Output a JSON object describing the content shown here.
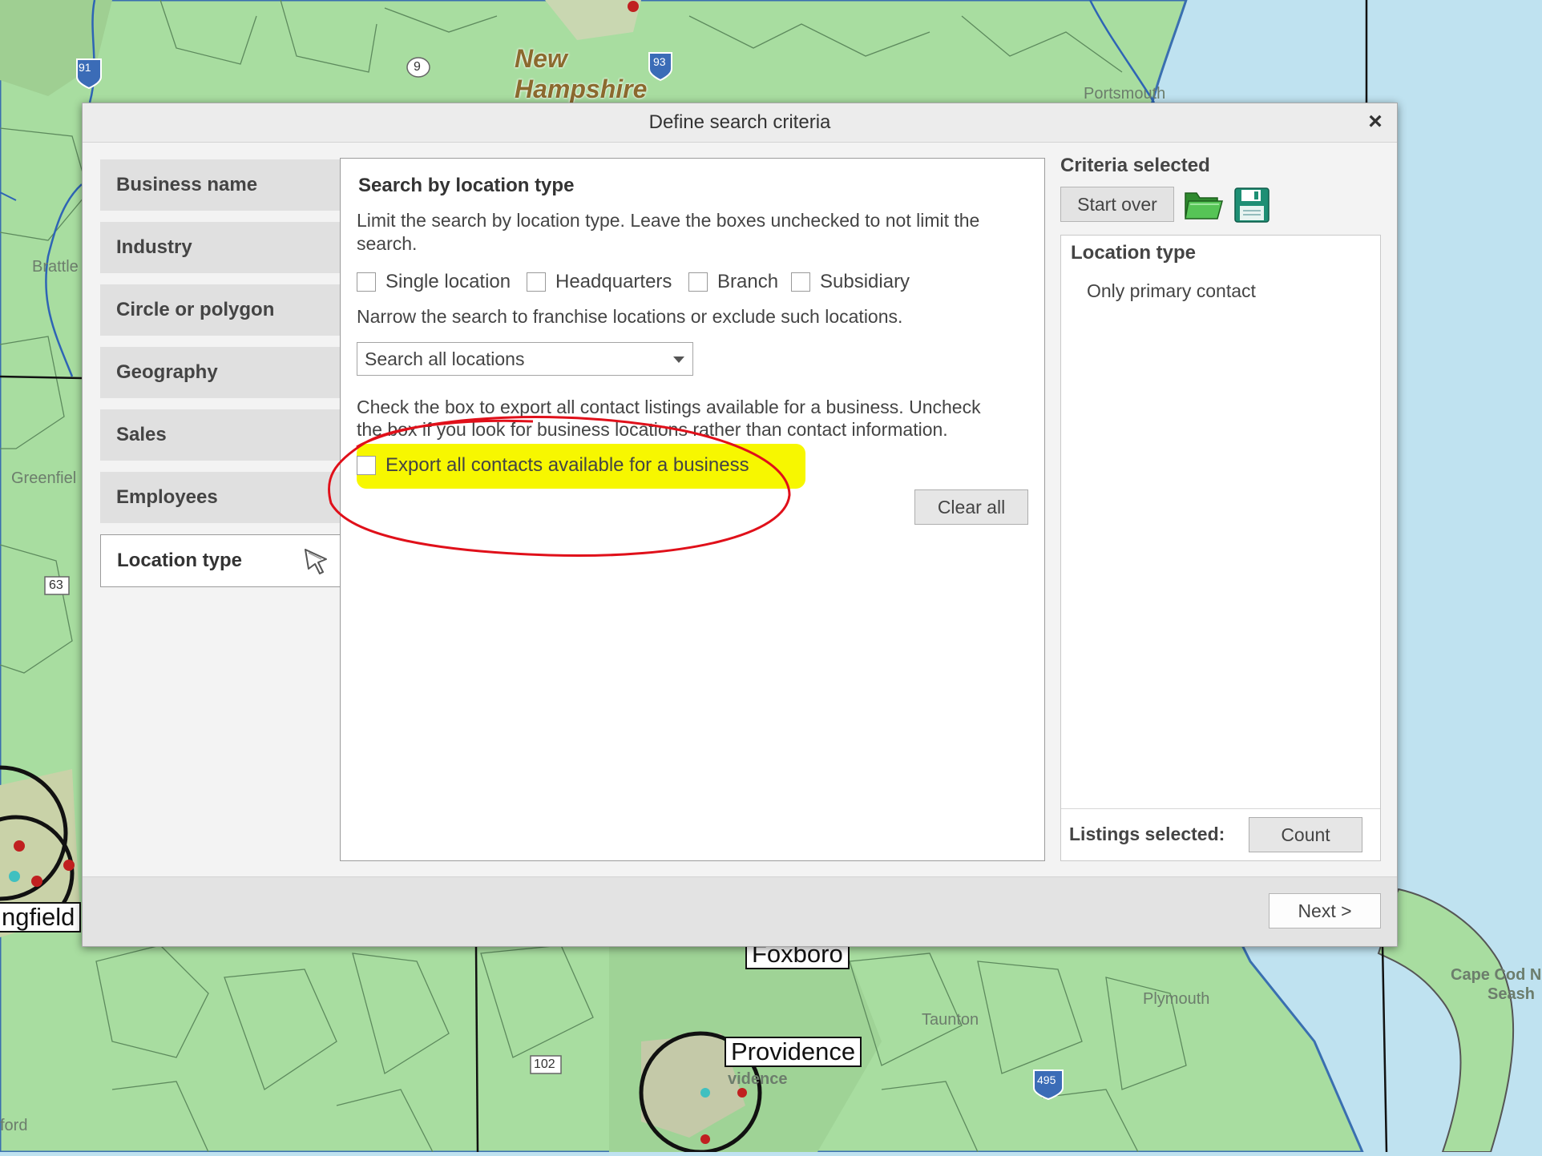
{
  "map": {
    "state_label_line1": "New",
    "state_label_line2": "Hampshire",
    "cities": {
      "springfield": "ngfield",
      "foxboro": "Foxboro",
      "providence": "Providence"
    },
    "towns": {
      "brattle": "Brattle",
      "greenfield": "Greenfiel",
      "plymouth": "Plymouth",
      "cape_cod": "Cape Cod N",
      "seash": "Seash",
      "taunton": "Taunton",
      "portsmouth": "Portsmouth",
      "hartford": "ford",
      "providence_small": "vidence"
    },
    "route_shields": {
      "r63": "63",
      "r93": "93",
      "r102": "102",
      "r495": "495",
      "r9": "9",
      "r91": "91"
    }
  },
  "dialog": {
    "title": "Define search criteria",
    "close_label": "×",
    "nav": [
      {
        "label": "Business name"
      },
      {
        "label": "Industry"
      },
      {
        "label": "Circle or polygon"
      },
      {
        "label": "Geography"
      },
      {
        "label": "Sales"
      },
      {
        "label": "Employees"
      },
      {
        "label": "Location type",
        "active": true
      }
    ],
    "center": {
      "heading": "Search by location type",
      "limit_line1": "Limit the search by location type. Leave the boxes unchecked to not limit the",
      "limit_line2": "search.",
      "checkboxes": [
        {
          "label": "Single location",
          "checked": false
        },
        {
          "label": "Headquarters",
          "checked": false
        },
        {
          "label": "Branch",
          "checked": false
        },
        {
          "label": "Subsidiary",
          "checked": false
        }
      ],
      "franchise_text": "Narrow the search to franchise locations or exclude such locations.",
      "franchise_select_value": "Search all locations",
      "export_line1": "Check the box to export all contact listings available for a business. Uncheck",
      "export_line2": "the box if you look for business locations rather than contact information.",
      "export_checkbox_label": "Export all contacts available for a business",
      "export_checked": false,
      "clear_all_label": "Clear all"
    },
    "right": {
      "heading": "Criteria selected",
      "start_over_label": "Start over",
      "panel_title": "Location type",
      "panel_value": "Only primary contact",
      "listings_label": "Listings selected:",
      "count_label": "Count"
    },
    "footer": {
      "next_label": "Next >"
    }
  },
  "colors": {
    "map_land": "#a8dda0",
    "map_water": "#bfe2f0",
    "highlight": "#f7f700",
    "annotation_red": "#e0101a"
  }
}
